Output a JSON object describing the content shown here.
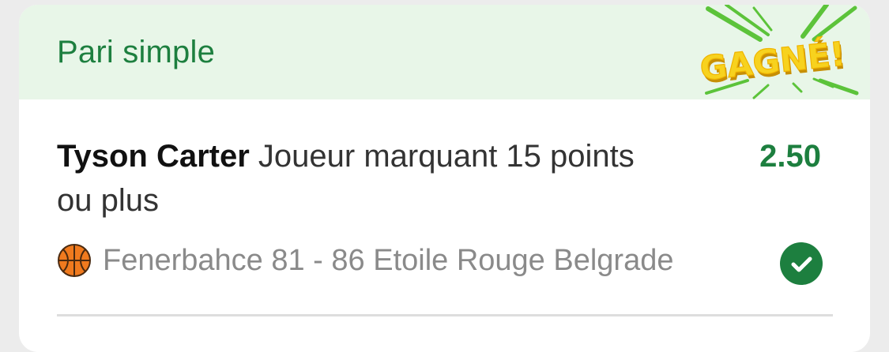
{
  "header": {
    "title": "Pari simple",
    "badge_text": "GAGNÉ!"
  },
  "selection": {
    "player": "Tyson Carter",
    "market": "Joueur marquant 15 points ou plus",
    "odds": "2.50"
  },
  "match": {
    "sport_icon": "basketball-icon",
    "text": "Fenerbahce 81 - 86 Etoile Rouge Belgrade",
    "status_icon": "check-circle-icon",
    "status": "won"
  },
  "colors": {
    "accent": "#1d7f3f",
    "header_bg": "#e8f6e8",
    "badge_yellow": "#f7d21e",
    "rays": "#5cc33a",
    "basketball": "#f07a1e"
  }
}
